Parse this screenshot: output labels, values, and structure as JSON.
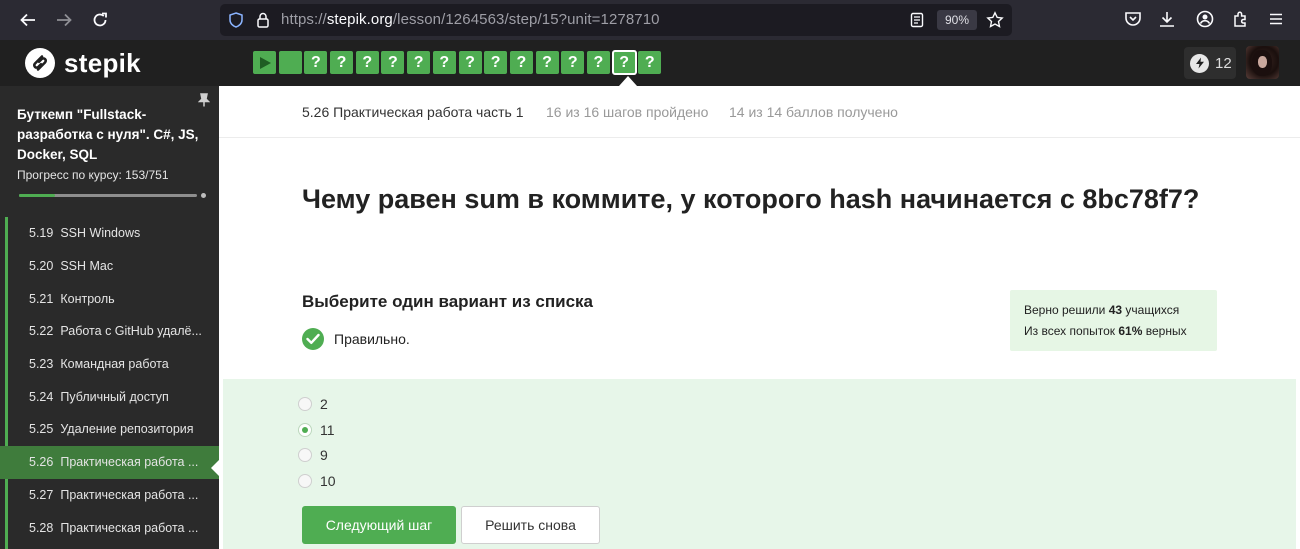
{
  "browser": {
    "url_prefix": "https://",
    "url_host": "stepik.org",
    "url_path": "/lesson/1264563/step/15?unit=1278710",
    "zoom": "90%"
  },
  "header": {
    "logo_text": "stepik",
    "step_count": 16,
    "active_step_index": 14,
    "energy_count": "12"
  },
  "sidebar": {
    "course_title": "Буткемп \"Fullstack-разработка с нуля\". C#, JS, Docker, SQL",
    "progress_label": "Прогресс по курсу:  153/751",
    "progress_fraction": 0.2037,
    "lessons": [
      {
        "num": "5.19",
        "title": "SSH Windows"
      },
      {
        "num": "5.20",
        "title": "SSH Mac"
      },
      {
        "num": "5.21",
        "title": "Контроль"
      },
      {
        "num": "5.22",
        "title": "Работа с GitHub удалё..."
      },
      {
        "num": "5.23",
        "title": "Командная работа"
      },
      {
        "num": "5.24",
        "title": "Публичный доступ"
      },
      {
        "num": "5.25",
        "title": "Удаление репозитория"
      },
      {
        "num": "5.26",
        "title": "Практическая работа ..."
      },
      {
        "num": "5.27",
        "title": "Практическая работа ..."
      },
      {
        "num": "5.28",
        "title": "Практическая работа ..."
      }
    ],
    "active_lesson_index": 7
  },
  "main": {
    "step_title": "5.26 Практическая работа часть 1",
    "steps_passed": "16 из 16 шагов пройдено",
    "score": "14 из 14 баллов  получено",
    "question": "Чему равен sum в коммите, у которого hash начинается с 8bc78f7?",
    "choose_label": "Выберите один вариант из списка",
    "correct_text": "Правильно.",
    "stats": {
      "line1_prefix": "Верно решили ",
      "line1_value": "43",
      "line1_suffix": " учащихся",
      "line2_prefix": "Из всех попыток ",
      "line2_value": "61%",
      "line2_suffix": " верных"
    },
    "options": [
      "2",
      "11",
      "9",
      "10"
    ],
    "selected_option_index": 1,
    "next_button": "Следующий шаг",
    "retry_button": "Решить снова"
  }
}
